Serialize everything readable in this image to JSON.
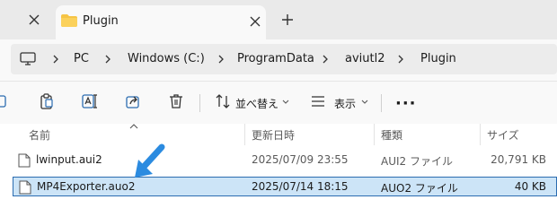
{
  "window": {
    "tab_title": "Plugin",
    "icons": [
      "close-icon",
      "folder-icon",
      "plus-icon"
    ]
  },
  "address_bar": {
    "crumbs": [
      "PC",
      "Windows (C:)",
      "ProgramData",
      "aviutl2",
      "Plugin"
    ]
  },
  "command_bar": {
    "sort_label": "並べ替え",
    "view_label": "表示",
    "more_label": "···"
  },
  "file_list": {
    "columns": {
      "name": "名前",
      "date": "更新日時",
      "type": "種類",
      "size": "サイズ"
    },
    "rows": [
      {
        "name": "lwinput.aui2",
        "date": "2025/07/09 23:55",
        "type": "AUI2 ファイル",
        "size": "20,791 KB",
        "selected": false
      },
      {
        "name": "MP4Exporter.auo2",
        "date": "2025/07/14 18:15",
        "type": "AUO2 ファイル",
        "size": "40 KB",
        "selected": true
      }
    ]
  },
  "colors": {
    "selection_bg": "#cce4f7",
    "selection_border": "#2b6cb0",
    "annotation_arrow": "#2b8be0",
    "folder": "#f6c445"
  }
}
